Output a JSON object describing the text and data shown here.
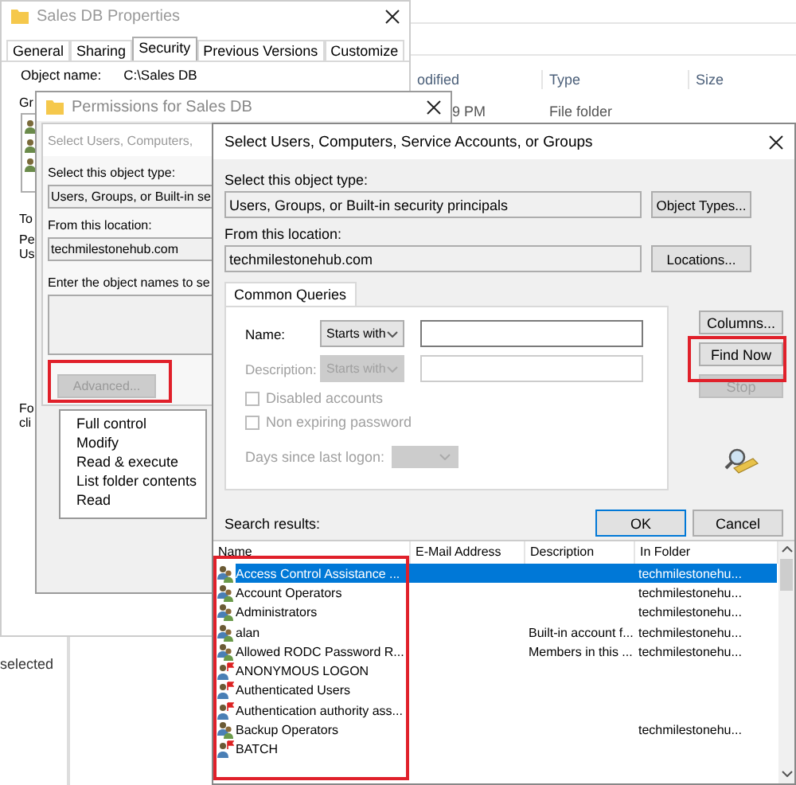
{
  "explorer": {
    "columns": [
      "odified",
      "Type",
      "Size"
    ],
    "row": {
      "modified": "9 PM",
      "type": "File folder"
    },
    "status": "selected"
  },
  "properties": {
    "title": "Sales DB Properties",
    "tabs": [
      {
        "label": "General",
        "selected": false
      },
      {
        "label": "Sharing",
        "selected": false
      },
      {
        "label": "Security",
        "selected": true
      },
      {
        "label": "Previous Versions",
        "selected": false
      },
      {
        "label": "Customize",
        "selected": false
      }
    ],
    "object_label": "Object name:",
    "object_value": "C:\\Sales DB",
    "cut_labels": [
      "Gr",
      "To",
      "Pe",
      "Us",
      "Fo",
      "cli"
    ]
  },
  "permissions": {
    "title": "Permissions for Sales DB",
    "select_dialog": {
      "title": "Select Users, Computers, ",
      "object_type_label": "Select this object type:",
      "object_type": "Users, Groups, or Built-in se",
      "location_label": "From this location:",
      "location": "techmilestonehub.com",
      "names_label": "Enter the object names to se",
      "advanced_button": {
        "label": "Advanced...",
        "disabled": true
      }
    },
    "rights": [
      "Full control",
      "Modify",
      "Read & execute",
      "List folder contents",
      "Read"
    ]
  },
  "main": {
    "title": "Select Users, Computers, Service Accounts, or Groups",
    "object_type_label": "Select this object type:",
    "object_type": "Users, Groups, or Built-in security principals",
    "object_types_button": "Object Types...",
    "location_label": "From this location:",
    "location": "techmilestonehub.com",
    "locations_button": "Locations...",
    "query_tab": "Common Queries",
    "name_row": {
      "label": "Name:",
      "operator": "Starts with",
      "disabled": false
    },
    "description_row": {
      "label": "Description:",
      "operator": "Starts with",
      "disabled": true
    },
    "checkboxes": [
      {
        "label": "Disabled accounts",
        "checked": false,
        "disabled": true
      },
      {
        "label": "Non expiring password",
        "checked": false,
        "disabled": true
      }
    ],
    "days_label": "Days since last logon:",
    "days_disabled": true,
    "side_buttons": [
      {
        "label": "Columns...",
        "disabled": false
      },
      {
        "label": "Find Now",
        "disabled": false
      },
      {
        "label": "Stop",
        "disabled": true
      }
    ],
    "ok": "OK",
    "cancel": "Cancel",
    "results_label": "Search results:",
    "columns": [
      "Name",
      "E-Mail Address",
      "Description",
      "In Folder"
    ],
    "rows": [
      {
        "kind": "group",
        "name": "Access Control Assistance ...",
        "folder": "techmilestonehu...",
        "selected": true
      },
      {
        "kind": "group",
        "name": "Account Operators",
        "folder": "techmilestonehu...",
        "selected": false
      },
      {
        "kind": "group",
        "name": "Administrators",
        "folder": "techmilestonehu...",
        "selected": false
      },
      {
        "kind": "group",
        "name": "alan",
        "description": "Built-in account f...",
        "folder": "techmilestonehu...",
        "selected": false
      },
      {
        "kind": "group",
        "name": "Allowed RODC Password R...",
        "description": "Members in this ...",
        "folder": "techmilestonehu...",
        "selected": false
      },
      {
        "kind": "principal",
        "name": "ANONYMOUS LOGON",
        "selected": false
      },
      {
        "kind": "principal",
        "name": "Authenticated Users",
        "selected": false
      },
      {
        "kind": "principal",
        "name": "Authentication authority ass...",
        "selected": false
      },
      {
        "kind": "group",
        "name": "Backup Operators",
        "folder": "techmilestonehu...",
        "selected": false
      },
      {
        "kind": "principal",
        "name": "BATCH",
        "selected": false
      }
    ]
  }
}
